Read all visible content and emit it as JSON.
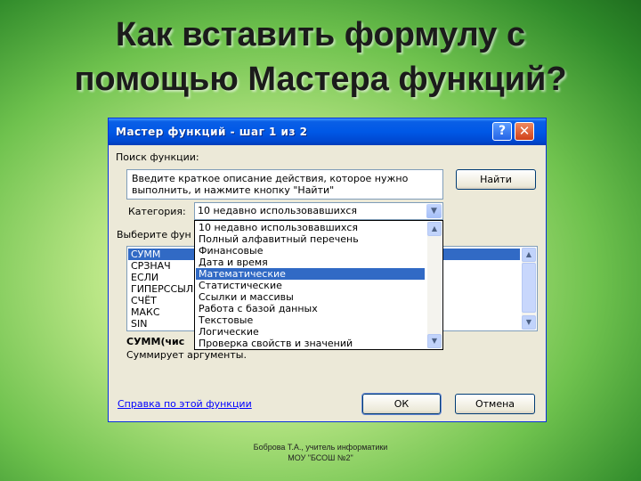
{
  "slide": {
    "title_line1": "Как вставить формулу с",
    "title_line2": "помощью Мастера функций?",
    "footer_line1": "Боброва Т.А., учитель информатики",
    "footer_line2": "МОУ \"БСОШ №2\""
  },
  "dialog": {
    "title": "Мастер функций - шаг 1 из 2",
    "help_glyph": "?",
    "close_glyph": "✕",
    "search_label": "Поиск функции:",
    "search_text": "Введите краткое описание действия, которое нужно выполнить, и нажмите кнопку \"Найти\"",
    "find_button": "Найти",
    "category_label": "Категория:",
    "category_value": "10 недавно использовавшихся",
    "select_label": "Выберите фун",
    "functions": [
      "СУММ",
      "СРЗНАЧ",
      "ЕСЛИ",
      "ГИПЕРССЫЛ",
      "СЧЁТ",
      "МАКС",
      "SIN"
    ],
    "selected_function": "СУММ",
    "signature": "СУММ(чис",
    "description": "Суммирует аргументы.",
    "help_link": "Справка по этой функции",
    "ok_button": "ОК",
    "cancel_button": "Отмена",
    "dropdown_options": [
      "10 недавно использовавшихся",
      "Полный алфавитный перечень",
      "Финансовые",
      "Дата и время",
      "Математические",
      "Статистические",
      "Ссылки и массивы",
      "Работа с базой данных",
      "Текстовые",
      "Логические",
      "Проверка свойств и значений"
    ],
    "dropdown_highlighted": "Математические"
  },
  "colors": {
    "titlebar": "#0058e6",
    "selection": "#316ac5",
    "dialog_bg": "#ece9d8"
  }
}
